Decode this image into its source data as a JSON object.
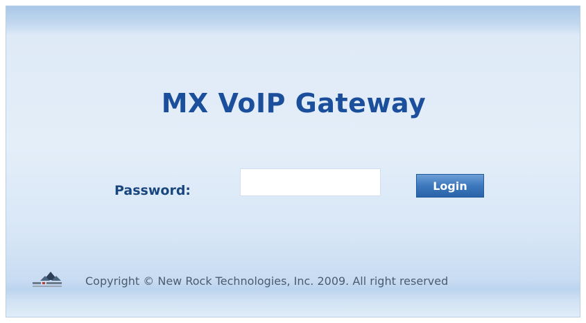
{
  "login": {
    "title": "MX VoIP Gateway",
    "password_label": "Password:",
    "password_value": "",
    "login_button": "Login"
  },
  "footer": {
    "logo_icon": "new-rock-logo-icon",
    "copyright": "Copyright © New Rock Technologies, Inc. 2009. All right reserved"
  },
  "colors": {
    "title": "#1b4f9c",
    "label": "#1a467e",
    "button": "#3d78bd",
    "background": "#e4eef9"
  }
}
